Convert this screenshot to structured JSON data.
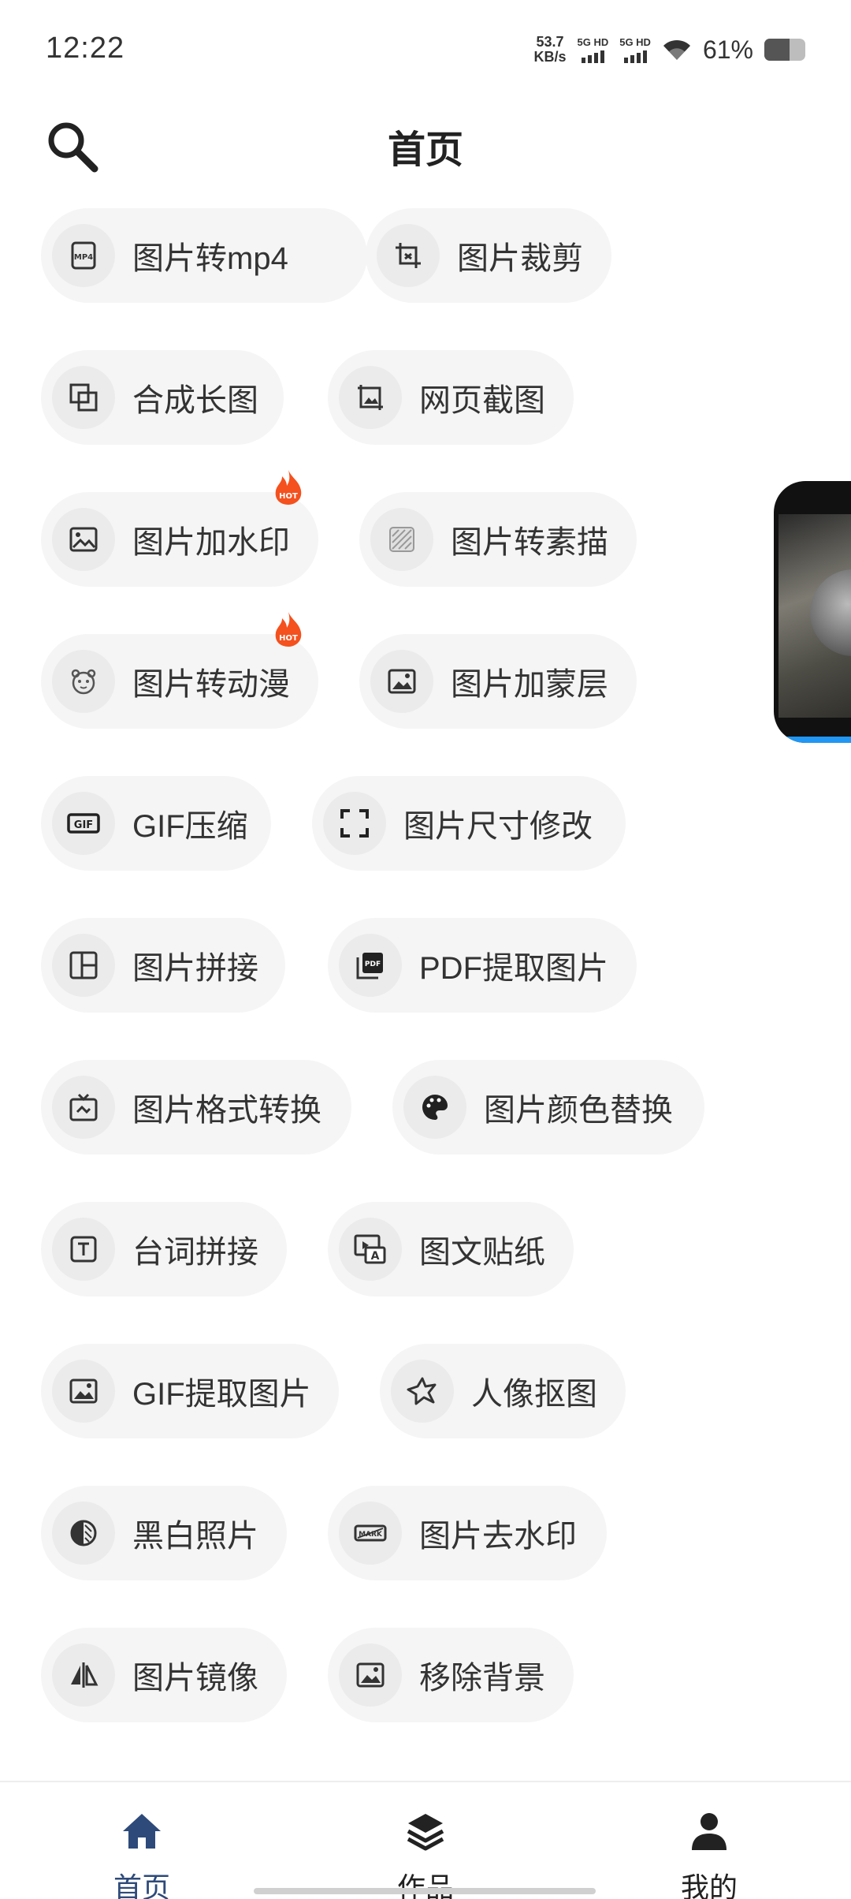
{
  "status_bar": {
    "time": "12:22",
    "net_speed_value": "53.7",
    "net_speed_unit": "KB/s",
    "sim1_label": "5G HD",
    "sim2_label": "5G HD",
    "battery_text": "61%",
    "battery_level": 0.61
  },
  "header": {
    "title": "首页",
    "search_icon": "search-icon"
  },
  "tools": [
    {
      "label": "图片转mp4",
      "icon": "mp4-icon",
      "hot": false
    },
    {
      "label": "图片裁剪",
      "icon": "crop-icon",
      "hot": false
    },
    {
      "label": "合成长图",
      "icon": "merge-icon",
      "hot": false
    },
    {
      "label": "网页截图",
      "icon": "web-screenshot-icon",
      "hot": false
    },
    {
      "label": "图片加水印",
      "icon": "watermark-icon",
      "hot": true
    },
    {
      "label": "图片转素描",
      "icon": "sketch-icon",
      "hot": false
    },
    {
      "label": "图片转动漫",
      "icon": "anime-icon",
      "hot": true
    },
    {
      "label": "图片加蒙层",
      "icon": "overlay-icon",
      "hot": false
    },
    {
      "label": "GIF压缩",
      "icon": "gif-icon",
      "hot": false
    },
    {
      "label": "图片尺寸修改",
      "icon": "resize-icon",
      "hot": false
    },
    {
      "label": "图片拼接",
      "icon": "collage-icon",
      "hot": false
    },
    {
      "label": "PDF提取图片",
      "icon": "pdf-icon",
      "hot": false
    },
    {
      "label": "图片格式转换",
      "icon": "format-convert-icon",
      "hot": false
    },
    {
      "label": "图片颜色替换",
      "icon": "palette-icon",
      "hot": false
    },
    {
      "label": "台词拼接",
      "icon": "text-icon",
      "hot": false
    },
    {
      "label": "图文贴纸",
      "icon": "sticker-icon",
      "hot": false
    },
    {
      "label": "GIF提取图片",
      "icon": "image-icon",
      "hot": false
    },
    {
      "label": "人像抠图",
      "icon": "cutout-icon",
      "hot": false
    },
    {
      "label": "黑白照片",
      "icon": "bw-icon",
      "hot": false
    },
    {
      "label": "图片去水印",
      "icon": "remove-watermark-icon",
      "hot": false
    },
    {
      "label": "图片镜像",
      "icon": "mirror-icon",
      "hot": false
    },
    {
      "label": "移除背景",
      "icon": "remove-bg-icon",
      "hot": false
    }
  ],
  "hot_badge_text": "HOT",
  "bottom_nav": [
    {
      "label": "首页",
      "icon": "home-icon",
      "active": true
    },
    {
      "label": "作品",
      "icon": "layers-icon",
      "active": false
    },
    {
      "label": "我的",
      "icon": "person-icon",
      "active": false
    }
  ],
  "colors": {
    "active_nav": "#2d4a7a",
    "pill_bg": "#f5f5f5",
    "icon_bg": "#ebebeb",
    "hot_flame": "#f4511e"
  }
}
